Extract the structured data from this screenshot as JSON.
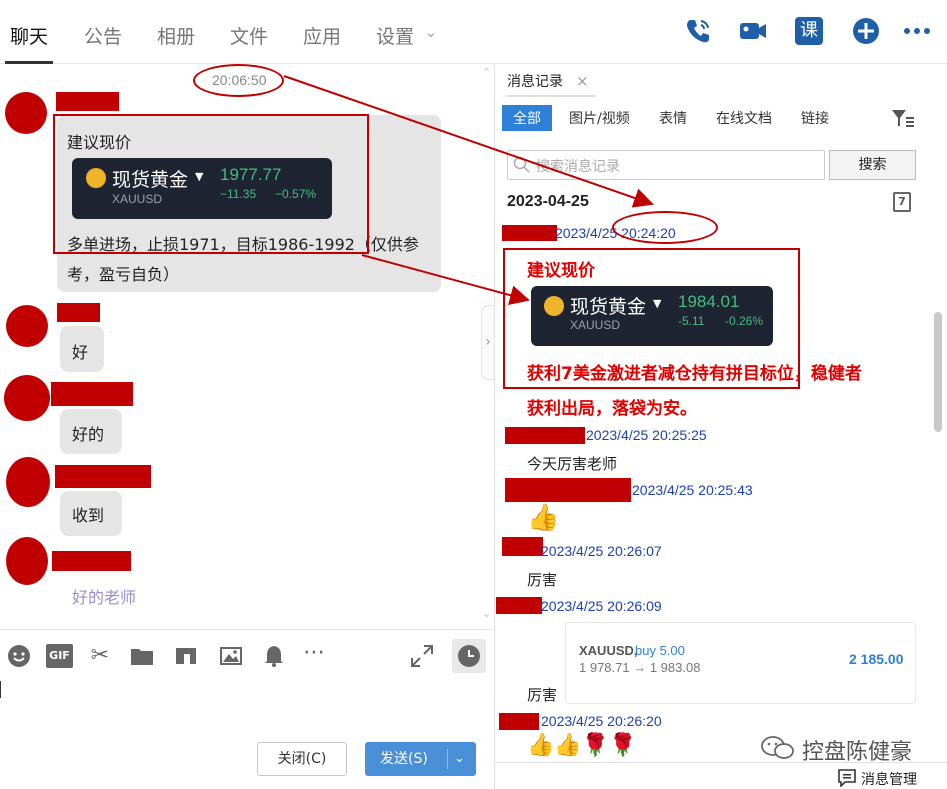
{
  "nav": {
    "tabs": [
      "聊天",
      "公告",
      "相册",
      "文件",
      "应用",
      "设置"
    ],
    "icons": [
      "phone-icon",
      "video-icon",
      "class-icon",
      "add-icon",
      "more-icon"
    ],
    "class_label": "课"
  },
  "chat": {
    "time": "20:06:50",
    "msg1_title": "建议现价",
    "ticker1": {
      "name": "现货黄金",
      "code": "XAUUSD",
      "price": "1977.77",
      "change": "−11.35",
      "pct": "−0.57%"
    },
    "msg1_body": "多单进场，止损1971，目标1986-1992（仅供参考，盈亏自负）",
    "replies": [
      "好",
      "好的",
      "收到",
      "好的老师"
    ]
  },
  "toolbar": {
    "gif_label": "GIF"
  },
  "buttons": {
    "close": "关闭(C)",
    "send": "发送(S)"
  },
  "history": {
    "title": "消息记录",
    "filters": [
      "全部",
      "图片/视频",
      "表情",
      "在线文档",
      "链接"
    ],
    "search_placeholder": "搜索消息记录",
    "search_button": "搜索",
    "date": "2023-04-25",
    "calendar_day": "7",
    "ts1": "2023/4/25 20:24:20",
    "msg_title": "建议现价",
    "ticker2": {
      "name": "现货黄金",
      "code": "XAUUSD",
      "price": "1984.01",
      "change": "-5.11",
      "pct": "-0.26%"
    },
    "profit_line1": "获利7美金激进者减仓持有拼目标位，稳健者",
    "profit_line2": "获利出局，落袋为安。",
    "ts2": "2023/4/25 20:25:25",
    "msg2": "今天厉害老师",
    "ts3": "2023/4/25 20:25:43",
    "emoji3": "👍",
    "ts4": "2023/4/25 20:26:07",
    "msg4": "厉害",
    "ts5": "2023/4/25 20:26:09",
    "trade": {
      "symbol": "XAUUSD,",
      "side": "buy 5.00",
      "prices": "1 978.71 → 1 983.08",
      "profit": "2 185.00"
    },
    "msg5": "厉害",
    "ts6": "2023/4/25 20:26:20",
    "emoji6": "👍👍🌹🌹",
    "manage": "消息管理"
  },
  "watermark": "控盘陈健豪",
  "colors": {
    "accent": "#2f80d8",
    "annotation_red": "#c00000",
    "timestamp_blue": "#1d3fb5"
  }
}
